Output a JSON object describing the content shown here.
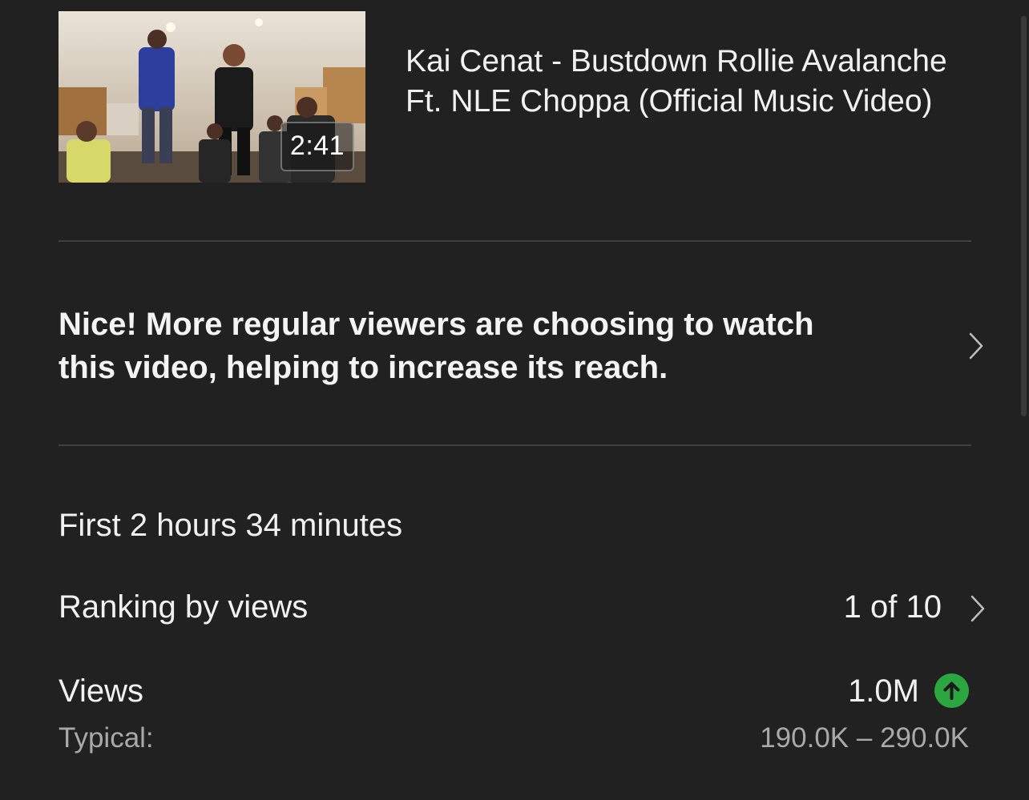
{
  "video": {
    "title": "Kai Cenat - Bustdown Rollie Avalanche Ft. NLE Choppa (Official Music Video)",
    "duration": "2:41"
  },
  "insight": {
    "text": "Nice! More regular viewers are choosing to watch this video, helping to increase its reach.",
    "icon": "chevron-right-icon"
  },
  "stats": {
    "period": "First 2 hours 34 minutes",
    "ranking": {
      "label": "Ranking by views",
      "value": "1 of 10",
      "icon": "chevron-right-icon"
    },
    "views": {
      "label": "Views",
      "value": "1.0M",
      "trend_icon": "arrow-up-icon",
      "trend_color": "#2ba640",
      "typical_label": "Typical:",
      "typical_value": "190.0K – 290.0K"
    }
  },
  "theme": {
    "background": "#212121",
    "divider": "#3f3f3f",
    "text_primary": "#f1f1f1",
    "text_secondary": "#a9a9a9"
  }
}
